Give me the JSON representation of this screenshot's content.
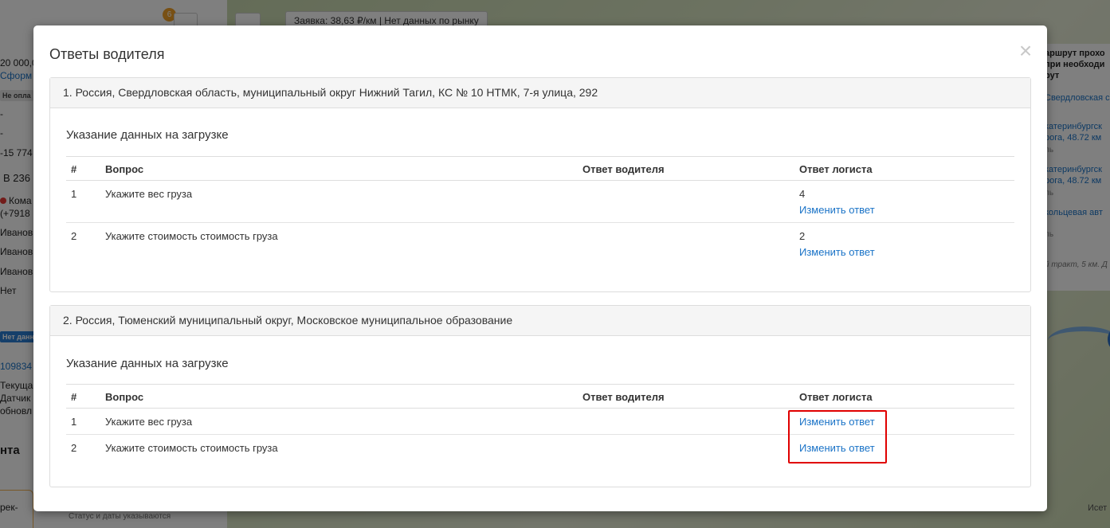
{
  "background": {
    "left_panel": {
      "badge_count": "6",
      "lines": [
        "20 000,0",
        "Сформ",
        "Не опла",
        "-",
        "-",
        "-15 774",
        "В 236",
        "Кома",
        "(+7918",
        "Иванов",
        "Иванов",
        "Иванов",
        "Нет",
        "Нет данн",
        "109834",
        "Текуща",
        "Датчик",
        "обновл",
        "нта",
        "рек-"
      ],
      "small_note": "Статус и даты указываются"
    },
    "map": {
      "top_chip": "Заявка: 38,63 ₽/км  |  Нет данных по рынку",
      "label_bottom_right": "Исет"
    },
    "right_panel": {
      "lines": [
        "аршрут прохо",
        "при необходи",
        "рут",
        "Свердловская с",
        "катеринбургск",
        "рога, 48.72 км",
        "ль",
        "катеринбургск",
        "рога, 48.72 км",
        "ль",
        "кольцевая авт",
        "ль",
        "й тракт, 5 км. Д"
      ]
    }
  },
  "modal": {
    "title": "Ответы водителя",
    "close_glyph": "×",
    "table_headers": {
      "num": "#",
      "question": "Вопрос",
      "driver": "Ответ водителя",
      "logist": "Ответ логиста"
    },
    "points": [
      {
        "heading": "1. Россия, Свердловская область, муниципальный округ Нижний Тагил, КС № 10 НТМК, 7-я улица, 292",
        "section_title": "Указание данных на загрузке",
        "rows": [
          {
            "num": "1",
            "question": "Укажите вес груза",
            "driver_answer": "",
            "logist_answer": "4",
            "action": "Изменить ответ"
          },
          {
            "num": "2",
            "question": "Укажите стоимость стоимость груза",
            "driver_answer": "",
            "logist_answer": "2",
            "action": "Изменить ответ"
          }
        ]
      },
      {
        "heading": "2. Россия, Тюменский муниципальный округ, Московское муниципальное образование",
        "section_title": "Указание данных на загрузке",
        "rows": [
          {
            "num": "1",
            "question": "Укажите вес груза",
            "driver_answer": "",
            "logist_answer": "",
            "action": "Изменить ответ"
          },
          {
            "num": "2",
            "question": "Укажите стоимость стоимость груза",
            "driver_answer": "",
            "logist_answer": "",
            "action": "Изменить ответ"
          }
        ]
      }
    ]
  },
  "colors": {
    "link": "#1a73c7",
    "highlight": "#e00000",
    "overlay": "rgba(0,0,0,0.5)"
  }
}
